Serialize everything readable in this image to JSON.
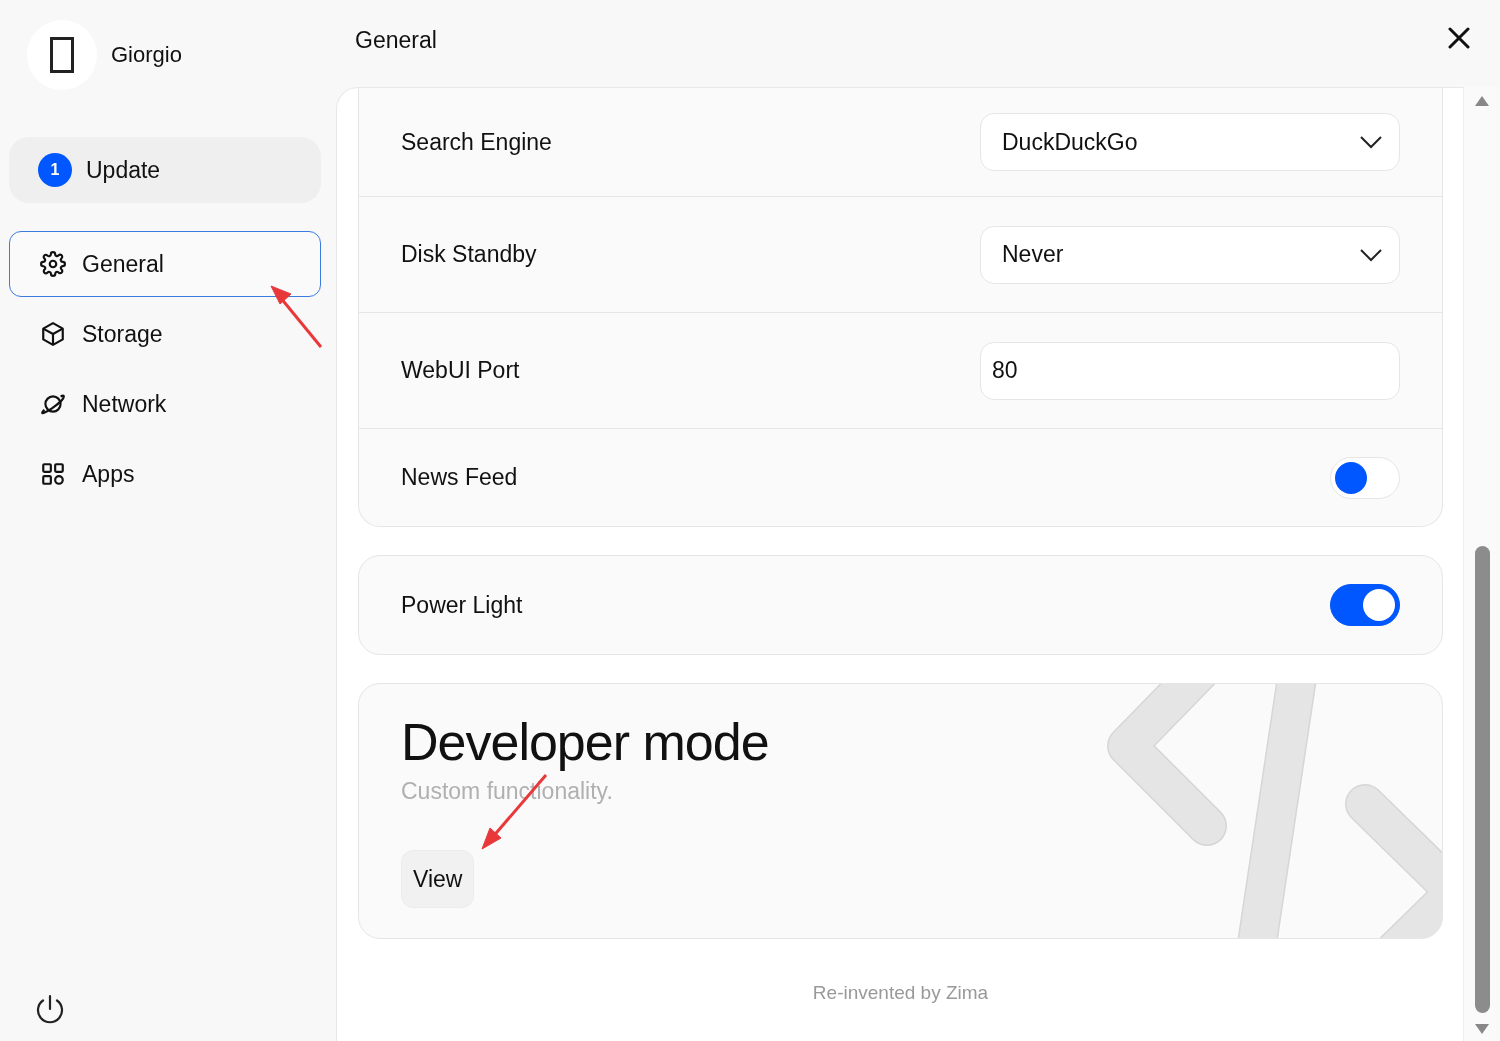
{
  "sidebar": {
    "profile": {
      "name": "Giorgio"
    },
    "update": {
      "label": "Update",
      "count": "1"
    },
    "items": [
      {
        "label": "General",
        "kind": "gear",
        "selected": true
      },
      {
        "label": "Storage",
        "kind": "cube",
        "selected": false
      },
      {
        "label": "Network",
        "kind": "planet",
        "selected": false
      },
      {
        "label": "Apps",
        "kind": "grid",
        "selected": false
      }
    ]
  },
  "header": {
    "title": "General"
  },
  "settings": [
    {
      "kind": "select",
      "label": "Search Engine",
      "value": "DuckDuckGo"
    },
    {
      "kind": "select",
      "label": "Disk Standby",
      "value": "Never"
    },
    {
      "kind": "input",
      "label": "WebUI Port",
      "value": "80"
    },
    {
      "kind": "toggle",
      "label": "News Feed",
      "on": false
    }
  ],
  "power_light": {
    "label": "Power Light",
    "on": true
  },
  "developer": {
    "title": "Developer mode",
    "subtitle": "Custom functionality.",
    "button": "View"
  },
  "footer": "Re-invented by Zima"
}
